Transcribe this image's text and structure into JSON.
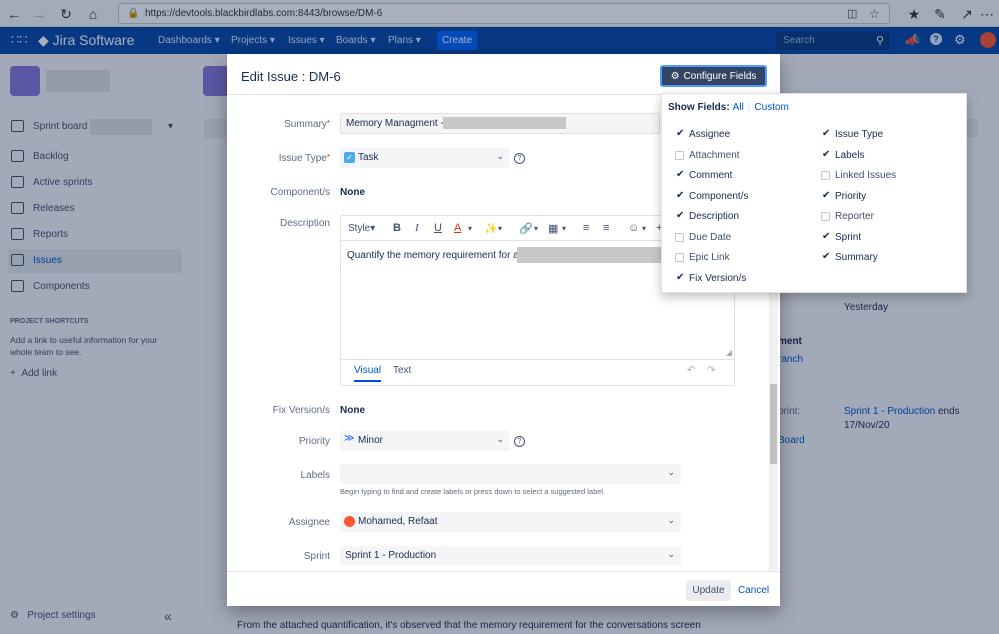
{
  "browser": {
    "url": "https://devtools.blackbirdlabs.com:8443/browse/DM-6"
  },
  "nav": {
    "brand": "Jira Software",
    "items": [
      "Dashboards",
      "Projects",
      "Issues",
      "Boards",
      "Plans"
    ],
    "create": "Create",
    "search_placeholder": "Search"
  },
  "sidebar": {
    "sprint_board": "Sprint board",
    "items": [
      "Backlog",
      "Active sprints",
      "Releases",
      "Reports",
      "Issues",
      "Components"
    ],
    "shortcuts_heading": "PROJECT SHORTCUTS",
    "shortcuts_text": "Add a link to useful information for your whole team to see.",
    "add_link": "Add link",
    "project_settings": "Project settings"
  },
  "background": {
    "yesterday": "Yesterday",
    "development": "ment",
    "branch": "ranch",
    "sprint_label": "print:",
    "sprint_value": "Sprint 1 - Production",
    "sprint_ends": "ends",
    "sprint_date": "17/Nov/20",
    "board": "Board",
    "bottom_text": "From the attached quantification, it's observed that the memory requirement for the conversations screen"
  },
  "modal": {
    "title": "Edit Issue : DM-6",
    "configure_fields": "Configure Fields",
    "fields": {
      "summary_label": "Summary",
      "summary_value": "Memory Managment -",
      "issue_type_label": "Issue Type",
      "issue_type_value": "Task",
      "components_label": "Component/s",
      "components_value": "None",
      "description_label": "Description",
      "description_value": "Quantify the memory requirement for a",
      "editor_style": "Style",
      "editor_tab_visual": "Visual",
      "editor_tab_text": "Text",
      "fix_version_label": "Fix Version/s",
      "fix_version_value": "None",
      "priority_label": "Priority",
      "priority_value": "Minor",
      "labels_label": "Labels",
      "labels_hint": "Begin typing to find and create labels or press down to select a suggested label.",
      "assignee_label": "Assignee",
      "assignee_value": "Mohamed, Refaat",
      "sprint_label": "Sprint",
      "sprint_value": "Sprint 1 - Production"
    },
    "update": "Update",
    "cancel": "Cancel"
  },
  "configure_popup": {
    "show_fields": "Show Fields:",
    "all": "All",
    "custom": "Custom",
    "left": [
      {
        "label": "Assignee",
        "checked": true
      },
      {
        "label": "Attachment",
        "checked": false
      },
      {
        "label": "Comment",
        "checked": true
      },
      {
        "label": "Component/s",
        "checked": true
      },
      {
        "label": "Description",
        "checked": true
      },
      {
        "label": "Due Date",
        "checked": false
      },
      {
        "label": "Epic Link",
        "checked": false
      },
      {
        "label": "Fix Version/s",
        "checked": true
      }
    ],
    "right": [
      {
        "label": "Issue Type",
        "checked": true
      },
      {
        "label": "Labels",
        "checked": true
      },
      {
        "label": "Linked Issues",
        "checked": false
      },
      {
        "label": "Priority",
        "checked": true
      },
      {
        "label": "Reporter",
        "checked": false
      },
      {
        "label": "Sprint",
        "checked": true
      },
      {
        "label": "Summary",
        "checked": true
      }
    ]
  },
  "colors": {
    "nav": "#0747a6",
    "accent": "#0052cc",
    "create": "#0065ff"
  }
}
